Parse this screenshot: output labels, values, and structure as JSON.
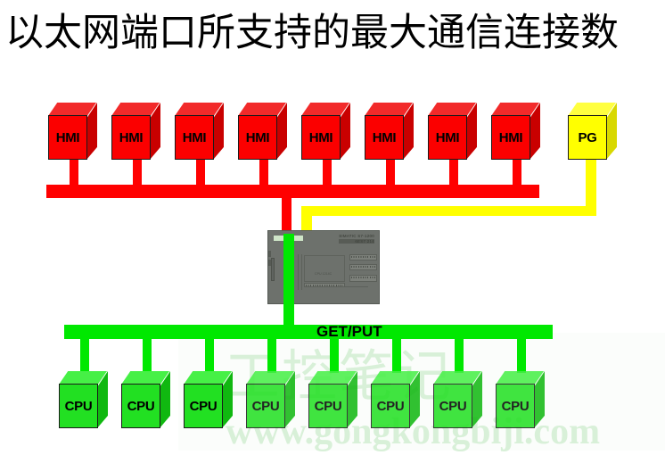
{
  "title": "以太网端口所支持的最大通信连接数",
  "watermark": {
    "chinese": "工控笔记",
    "url": "www.gongkongbiji.com"
  },
  "colors": {
    "hmi_bus": "#ff0000",
    "cpu_bus": "#00e800",
    "pg_link": "#ffff00",
    "plc_body": "#6d716c",
    "watermark": "#d8f0d8"
  },
  "top_row": {
    "hmi_nodes": [
      {
        "label": "HMI"
      },
      {
        "label": "HMI"
      },
      {
        "label": "HMI"
      },
      {
        "label": "HMI"
      },
      {
        "label": "HMI"
      },
      {
        "label": "HMI"
      },
      {
        "label": "HMI"
      },
      {
        "label": "HMI"
      }
    ],
    "pg_node": {
      "label": "PG"
    }
  },
  "plc": {
    "brand": "SIEMENS",
    "model_line1": "SIMATIC S7-1200",
    "model_line2": "6ES7 214",
    "panel_label": "CPU 1214C"
  },
  "bottom_row": {
    "bus_label": "GET/PUT",
    "cpu_nodes": [
      {
        "label": "CPU"
      },
      {
        "label": "CPU"
      },
      {
        "label": "CPU"
      },
      {
        "label": "CPU"
      },
      {
        "label": "CPU"
      },
      {
        "label": "CPU"
      },
      {
        "label": "CPU"
      },
      {
        "label": "CPU"
      }
    ]
  }
}
